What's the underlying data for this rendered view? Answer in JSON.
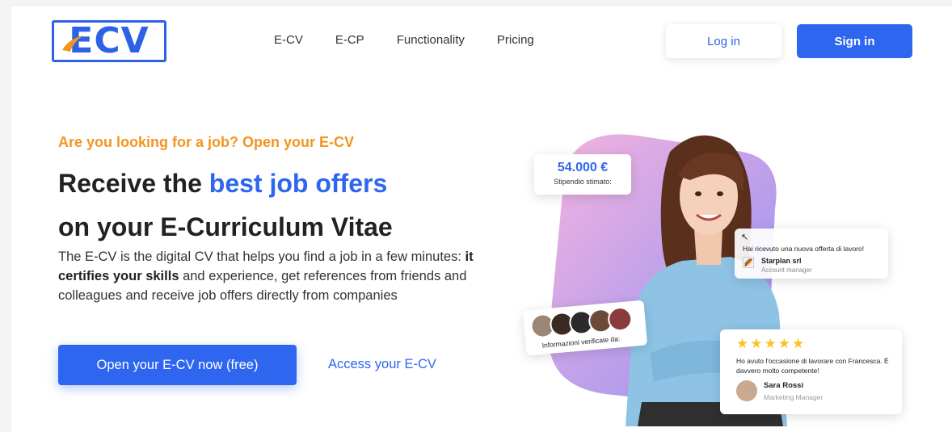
{
  "header": {
    "logo_text": "ECV",
    "nav": [
      "E-CV",
      "E-CP",
      "Functionality",
      "Pricing"
    ],
    "login_label": "Log in",
    "signin_label": "Sign in"
  },
  "hero": {
    "eyebrow": "Are you looking for a job? Open your E-CV",
    "headline_part1": "Receive the ",
    "headline_accent": "best job offers",
    "headline_part2": "on your E-Curriculum Vitae",
    "desc_part1": "The E-CV is the digital CV that helps you find a job in a few minutes: ",
    "desc_bold": "it certifies your skills",
    "desc_part2": " and experience, get references from friends and colleagues and receive job offers directly from companies",
    "cta_label": "Open your E-CV now (free)",
    "access_label": "Access your E-CV"
  },
  "illustration": {
    "salary_amount": "54.000 €",
    "salary_label": "Stipendio stimato:",
    "offer_arrow": "↖",
    "offer_message": "Hai ricevuto una nuova offerta di lavoro!",
    "offer_company": "Starplan srl",
    "offer_role": "Account manager",
    "verified_label": "Informazioni verificate da:",
    "review_stars": "★★★★★",
    "review_text": "Ho avuto l'occasione di lavorare con Francesca. È davvero molto competente!",
    "review_name": "Sara Rossi",
    "review_role": "Marketing Manager"
  },
  "colors": {
    "brand_blue": "#2e66f0",
    "accent_orange": "#f2951f",
    "star_yellow": "#f7c325"
  }
}
